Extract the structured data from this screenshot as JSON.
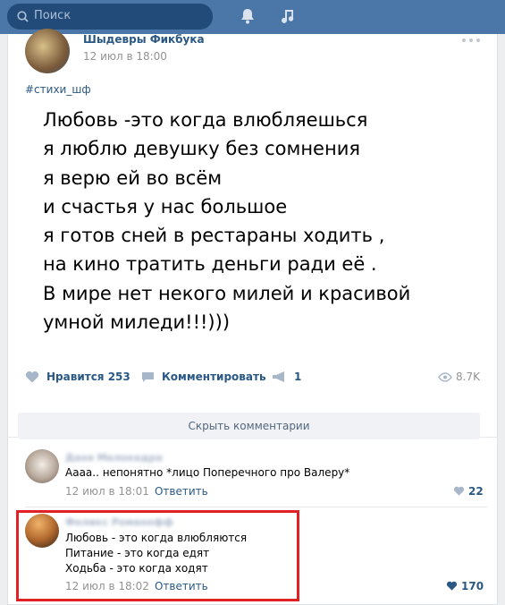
{
  "topbar": {
    "search_placeholder": "Поиск",
    "icons": [
      "search-icon",
      "bell-icon",
      "music-icon"
    ]
  },
  "post": {
    "author": "Шыдевры Фикбука",
    "date": "12 июл в 18:00",
    "hashtag": "#стихи_шф",
    "poem": [
      "Любовь -это когда влюбляешься",
      "я люблю девушку без сомнения",
      "я верю ей во всём",
      "и счастья у нас большое",
      "я готов сней в рестараны ходить ,",
      "на кино тратить деньги ради её .",
      "В мире нет некого милей и красивой",
      "умной миледи!!!)))"
    ],
    "actions": {
      "like_label": "Нравится",
      "like_count": "253",
      "comment_label": "Комментировать",
      "share_count": "1",
      "views": "8.7K"
    }
  },
  "comments": {
    "hide_label": "Скрыть комментарии",
    "items": [
      {
        "name": "Даня Мелокедра",
        "text": "Аааа.. непонятно *лицо Поперечного про Валеру*",
        "date": "12 июл в 18:01",
        "reply": "Ответить",
        "likes": "22"
      },
      {
        "name": "Феликс Романофф",
        "text": [
          "Любовь - это когда влюбляются",
          "Питание - это когда едят",
          "Ходьба - это когда ходят"
        ],
        "date": "12 июл в 18:02",
        "reply": "Ответить",
        "likes": "170"
      }
    ]
  },
  "colors": {
    "header": "#4a76a8",
    "link": "#2a5885",
    "muted": "#939393",
    "highlight": "#e02126"
  }
}
